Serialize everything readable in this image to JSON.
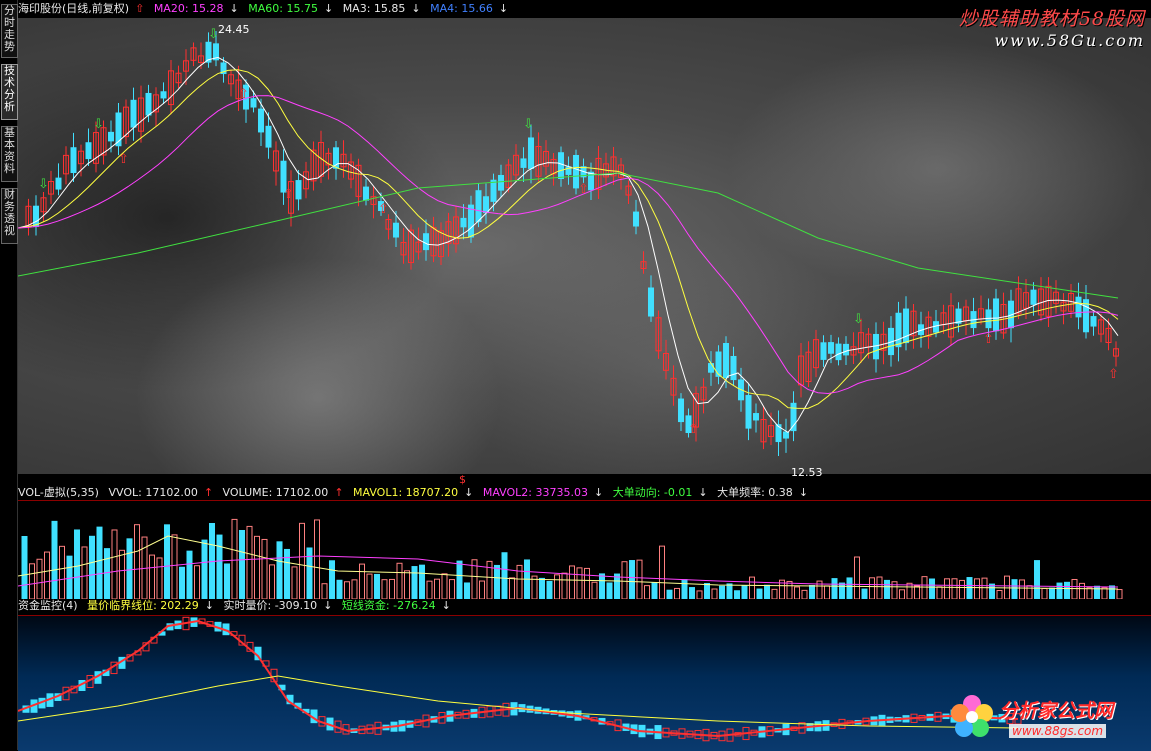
{
  "sidebar": {
    "tabs": [
      {
        "label": "分时走势",
        "active": false
      },
      {
        "label": "技术分析",
        "active": true
      },
      {
        "label": "基本资料",
        "active": false
      },
      {
        "label": "财务透视",
        "active": false
      }
    ]
  },
  "main_header": {
    "title": "海印股份(日线,前复权)",
    "ma20": "MA20: 15.28",
    "ma60": "MA60: 15.75",
    "ma3": "MA3: 15.85",
    "ma4": "MA4: 15.66"
  },
  "main_chart": {
    "high_label": "24.45",
    "low_label": "12.53",
    "colors": {
      "up": "#ff3030",
      "down": "#40e0ff",
      "ma_white": "#ffffff",
      "ma_yellow": "#ffff40",
      "ma_magenta": "#ff40ff",
      "ma_green": "#40e040"
    }
  },
  "vol_header": {
    "name": "VOL-虚拟(5,35)",
    "vvol": "VVOL: 17102.00",
    "volume": "VOLUME: 17102.00",
    "mavol1": "MAVOL1: 18707.20",
    "mavol2": "MAVOL2: 33735.03",
    "big_order": "大单动向: -0.01",
    "big_freq": "大单频率: 0.38"
  },
  "fund_header": {
    "name": "资金监控(4)",
    "critical": "量价临界线位: 202.29",
    "realtime": "实时量价: -309.10",
    "short": "短线资金: -276.24"
  },
  "logos": {
    "top_line1": "炒股辅助教材58股网",
    "top_line2": "www.58Gu.com",
    "bottom_line1": "分析家公式网",
    "bottom_line2": "www.88gs.com"
  },
  "cursor_marker": "$"
}
